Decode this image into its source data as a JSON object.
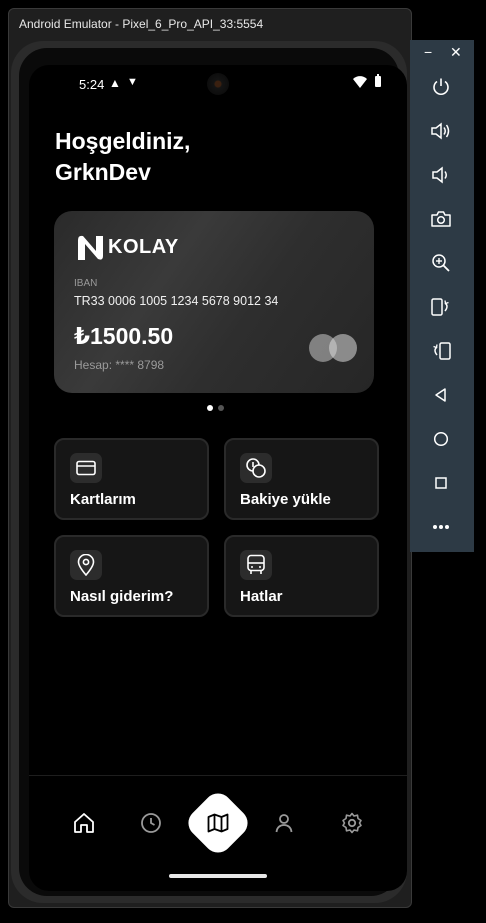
{
  "window": {
    "title": "Android Emulator - Pixel_6_Pro_API_33:5554"
  },
  "status_bar": {
    "time": "5:24"
  },
  "greeting": {
    "line1": "Hoşgeldiniz,",
    "line2": "GrknDev"
  },
  "card": {
    "brand": "KOLAY",
    "iban_label": "IBAN",
    "iban": "TR33 0006 1005 1234 5678 9012 34",
    "balance": "₺1500.50",
    "account": "Hesap: **** 8798"
  },
  "carousel": {
    "pages": 2,
    "active": 1
  },
  "tiles": [
    {
      "label": "Kartlarım",
      "icon": "credit-card-icon"
    },
    {
      "label": "Bakiye yükle",
      "icon": "coins-icon"
    },
    {
      "label": "Nasıl giderim?",
      "icon": "map-pin-icon"
    },
    {
      "label": "Hatlar",
      "icon": "bus-icon"
    }
  ],
  "bottom_nav": [
    {
      "icon": "home-icon"
    },
    {
      "icon": "clock-icon"
    },
    {
      "icon": "map-icon",
      "active": true
    },
    {
      "icon": "user-icon"
    },
    {
      "icon": "settings-icon"
    }
  ],
  "emulator_panel": {
    "buttons": [
      "minimize-icon",
      "close-icon",
      "power-icon",
      "volume-up-icon",
      "volume-down-icon",
      "camera-icon",
      "zoom-icon",
      "rotate-left-icon",
      "rotate-right-icon",
      "back-icon",
      "home-circle-icon",
      "overview-icon",
      "more-icon"
    ]
  },
  "colors": {
    "background": "#000000",
    "card": "#333333",
    "tile": "#161616",
    "panel": "#2d3a45"
  }
}
